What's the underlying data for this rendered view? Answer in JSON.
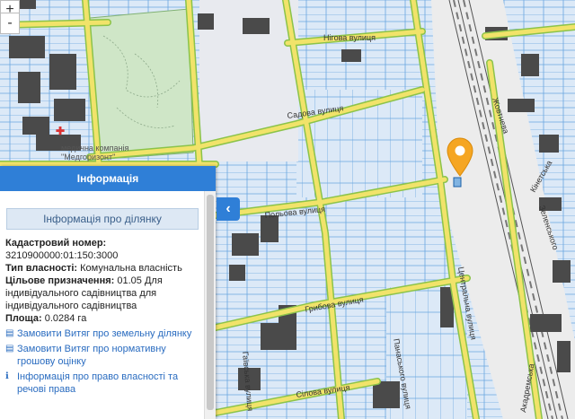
{
  "map": {
    "streets": {
      "nigova": "Нігова вулиця",
      "sadova": "Садова вулиця",
      "polova": "Польова вулиця",
      "hrybova": "Грибова вулиця",
      "tsentralna": "Центральна вулиця",
      "zhovtneva": "Жовтнева",
      "zelenskoho": "Зеленського",
      "sylova": "Сілова вулиця",
      "panaskoho": "Панаського вулиця",
      "haivska": "Гаївська вулиця",
      "kinetska": "Кінетська",
      "akadremska": "Акадремська"
    },
    "poi": {
      "med_line1": "медична компанія",
      "med_line2": "\"Медгоризонт\""
    },
    "colors": {
      "major_road": "#f1e36a",
      "major_road_border": "#9acd32",
      "parcel_line": "#3a8fdc",
      "parcel_fill": "#dce9f7",
      "building": "#4a4a4a",
      "park": "#cfe6c7",
      "marker": "#f5a623"
    }
  },
  "zoom": {
    "in": "+",
    "out": "-"
  },
  "panel": {
    "header": "Інформація",
    "parcel_title": "Інформація про ділянку",
    "cadastral_label": "Кадастровий номер:",
    "cadastral_value": "3210900000:01:150:3000",
    "ownership_label": "Тип власності:",
    "ownership_value": " Комунальна власність",
    "purpose_label": "Цільове призначення:",
    "purpose_value": " 01.05 Для індивідуального садівництва для індивідуального садівництва",
    "area_label": "Площа:",
    "area_value": " 0.0284 га",
    "links": [
      {
        "icon": "document-icon",
        "text": "Замовити Витяг про земельну ділянку"
      },
      {
        "icon": "document-icon",
        "text": "Замовити Витяг про нормативну грошову оцінку"
      },
      {
        "icon": "info-icon",
        "text": "Інформація про право власності та речові права"
      }
    ],
    "collapse_glyph": "‹"
  }
}
